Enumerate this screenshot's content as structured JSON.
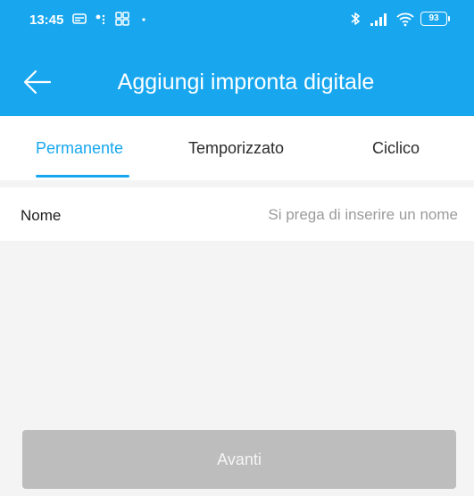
{
  "status_bar": {
    "time": "13:45",
    "battery": "93",
    "left_icons": [
      "message-icon",
      "dot-signal-icon",
      "grid-app-icon",
      "dot-icon"
    ],
    "right_icons": [
      "bluetooth-icon",
      "cell-signal-icon",
      "wifi-icon",
      "battery-icon"
    ]
  },
  "app_bar": {
    "title": "Aggiungi impronta digitale",
    "back_icon": "arrow-left-icon",
    "background_color": "#18a7ef"
  },
  "tabs": [
    {
      "label": "Permanente",
      "active": true
    },
    {
      "label": "Temporizzato",
      "active": false
    },
    {
      "label": "Ciclico",
      "active": false
    }
  ],
  "form": {
    "name_label": "Nome",
    "name_value": "",
    "name_placeholder": "Si prega di inserire un nome"
  },
  "actions": {
    "next_label": "Avanti",
    "next_enabled": false
  },
  "colors": {
    "accent": "#18a7ef",
    "disabled_button": "#bdbdbd",
    "background": "#f4f4f4"
  }
}
